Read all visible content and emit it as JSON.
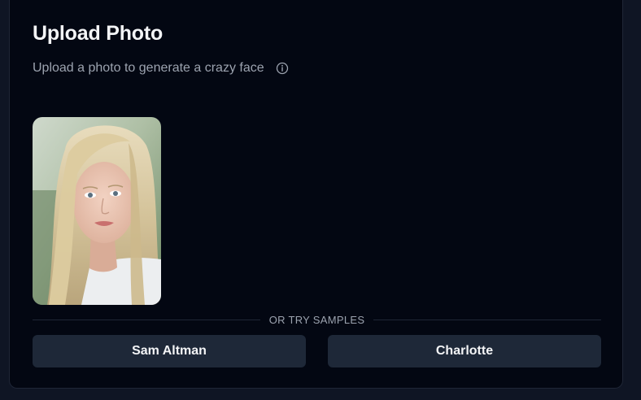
{
  "upload": {
    "title": "Upload Photo",
    "subtitle": "Upload a photo to generate a crazy face",
    "info_icon": "info-circle-icon",
    "photo_alt": "uploaded portrait"
  },
  "samples": {
    "divider_label": "OR TRY SAMPLES",
    "items": [
      {
        "label": "Sam Altman"
      },
      {
        "label": "Charlotte"
      }
    ]
  },
  "colors": {
    "background": "#030712",
    "card_border": "#1f2636",
    "button_bg": "#1e2838",
    "title_text": "#f3f4f6",
    "muted_text": "#9ca3af"
  }
}
